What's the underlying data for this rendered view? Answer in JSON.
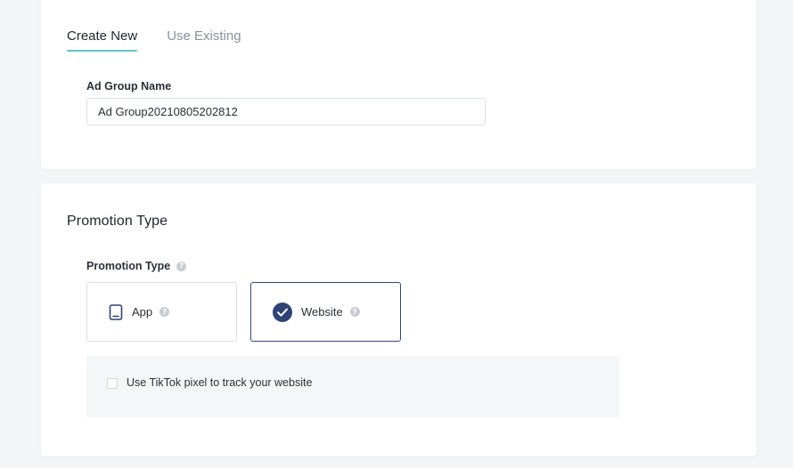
{
  "tabs": [
    {
      "label": "Create New",
      "active": true
    },
    {
      "label": "Use Existing",
      "active": false
    }
  ],
  "ad_group": {
    "label": "Ad Group Name",
    "value": "Ad Group20210805202812"
  },
  "promotion": {
    "section_title": "Promotion Type",
    "field_label": "Promotion Type",
    "options": [
      {
        "label": "App",
        "icon": "tablet-icon",
        "selected": false
      },
      {
        "label": "Website",
        "icon": "check-circle-icon",
        "selected": true
      }
    ],
    "pixel_checkbox": {
      "label": "Use TikTok pixel to track your website",
      "checked": false
    }
  },
  "colors": {
    "accent_underline": "#5fc5c3",
    "selected_border": "#33487a",
    "selected_check": "#2f4474"
  }
}
